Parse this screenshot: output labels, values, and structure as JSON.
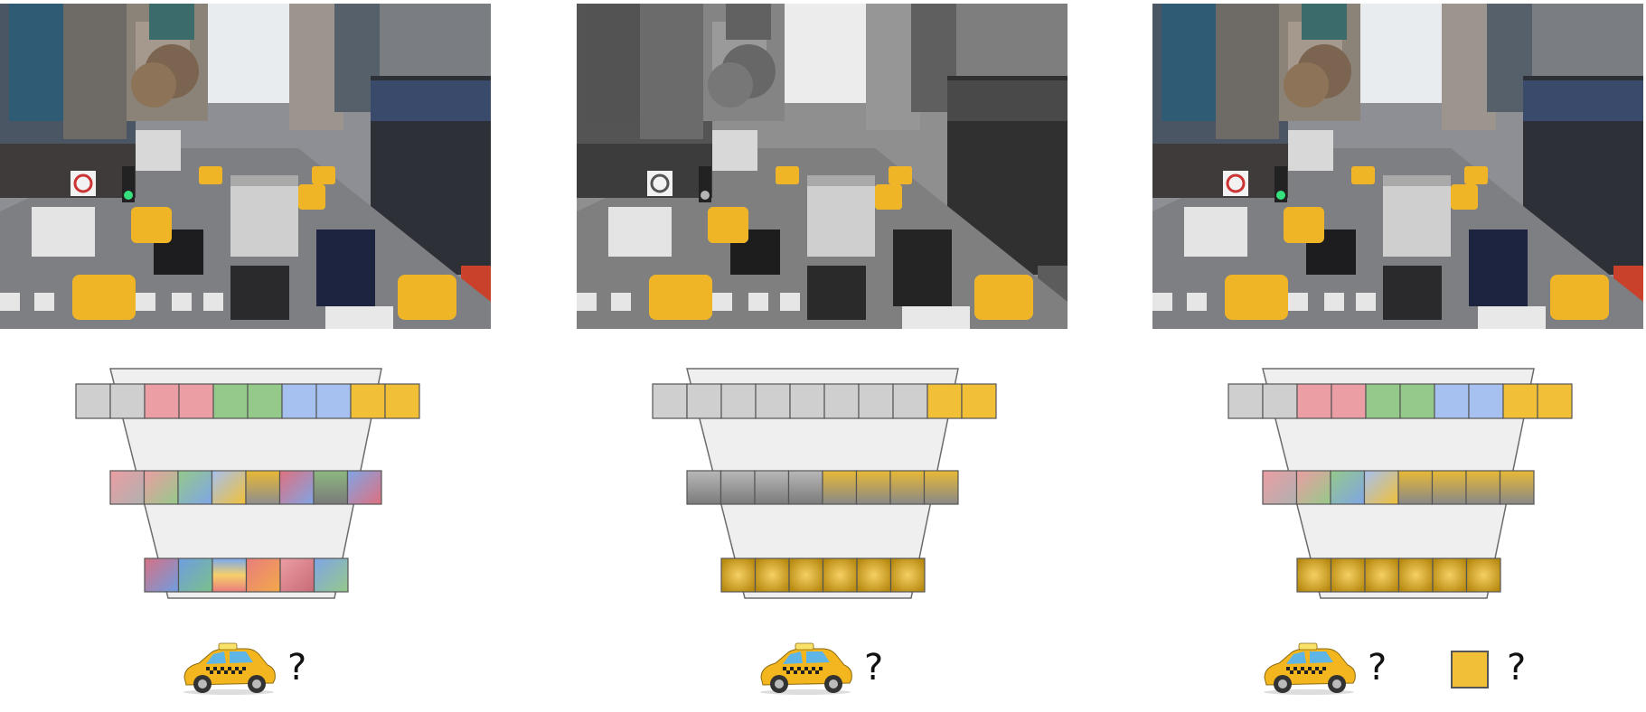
{
  "panels": [
    {
      "id": "left",
      "photo_mode": "color",
      "query": "?"
    },
    {
      "id": "middle",
      "photo_mode": "gray-except-taxis",
      "query": "?"
    },
    {
      "id": "right",
      "photo_mode": "color",
      "query_taxi": "?",
      "query_square": "?"
    }
  ],
  "colors": {
    "gray": "#CFCFCF",
    "red": "#EB9EA3",
    "green": "#95C98A",
    "blue": "#A6C1F0",
    "yellow": "#F2C037",
    "funnel": "#EFEFEF",
    "funnel_stroke": "#6b6b6b"
  },
  "icons": {
    "taxi": "taxi-icon",
    "square": "yellow-square-icon"
  }
}
